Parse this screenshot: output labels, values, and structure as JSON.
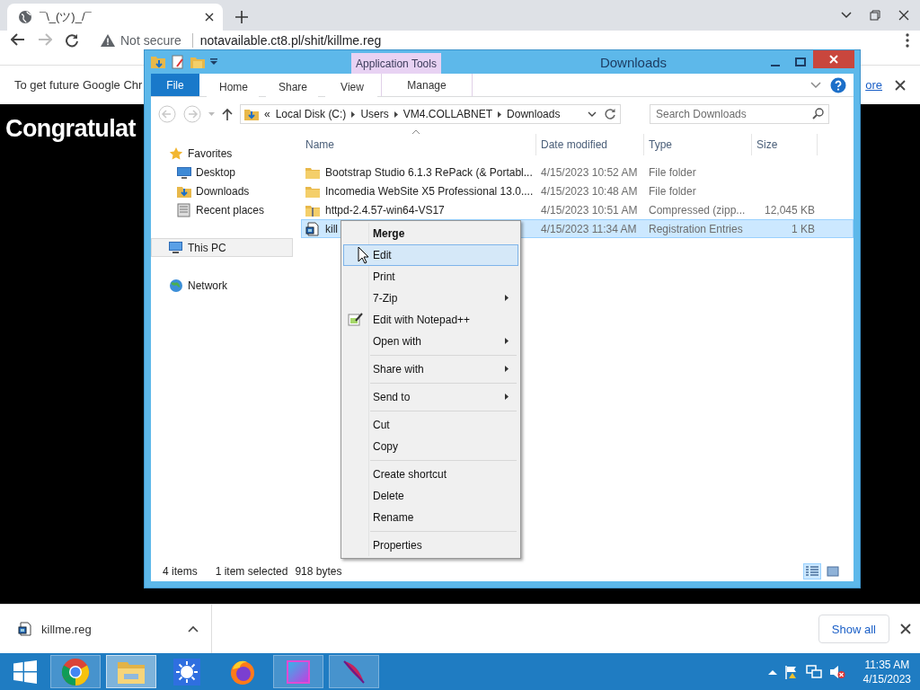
{
  "browser": {
    "tab": {
      "title": "¯\\_(ツ)_/¯"
    },
    "address": {
      "security": "Not secure",
      "url": "notavailable.ct8.pl/shit/killme.reg"
    },
    "infobar": {
      "message": "To get future Google Chr",
      "link": "ore"
    },
    "page": {
      "heading": "Congratulat"
    },
    "download_bar": {
      "file": "killme.reg",
      "button": "Show all"
    }
  },
  "explorer": {
    "title": "Downloads",
    "context_header": "Application Tools",
    "ribbon_tabs": [
      {
        "label": "File",
        "kind": "file"
      },
      {
        "label": "Home",
        "kind": "tab"
      },
      {
        "label": "Share",
        "kind": "tab"
      },
      {
        "label": "View",
        "kind": "tab"
      },
      {
        "label": "Manage",
        "kind": "contextual"
      }
    ],
    "breadcrumb": {
      "overflow": "«",
      "segments": [
        "Local Disk (C:)",
        "Users",
        "VM4.COLLABNET",
        "Downloads"
      ]
    },
    "search": {
      "placeholder": "Search Downloads"
    },
    "navigation": [
      {
        "label": "Favorites",
        "kind": "favorites",
        "selected": false,
        "children": [
          {
            "label": "Desktop",
            "kind": "desktop",
            "selected": false
          },
          {
            "label": "Downloads",
            "kind": "downloads",
            "selected": false
          },
          {
            "label": "Recent places",
            "kind": "recent",
            "selected": false
          }
        ]
      },
      {
        "label": "This PC",
        "kind": "pc",
        "selected": true
      },
      {
        "label": "Network",
        "kind": "network",
        "selected": false
      }
    ],
    "columns": [
      "Name",
      "Date modified",
      "Type",
      "Size"
    ],
    "files": [
      {
        "name": "Bootstrap Studio 6.1.3 RePack (& Portabl...",
        "date": "4/15/2023 10:52 AM",
        "type": "File folder",
        "kind": "folder",
        "selected": false
      },
      {
        "name": "Incomedia WebSite X5 Professional 13.0....",
        "date": "4/15/2023 10:48 AM",
        "type": "File folder",
        "kind": "folder",
        "selected": false
      },
      {
        "name": "httpd-2.4.57-win64-VS17",
        "date": "4/15/2023 10:51 AM",
        "type": "Compressed (zipp...",
        "size": "12,045 KB",
        "kind": "zip",
        "selected": false
      },
      {
        "name": "kill",
        "date": "4/15/2023 11:34 AM",
        "type": "Registration Entries",
        "size": "1 KB",
        "kind": "reg",
        "selected": true
      }
    ],
    "status": {
      "count": "4 items",
      "selection": "1 item selected",
      "bytes": "918 bytes"
    },
    "views": [
      {
        "kind": "details",
        "selected": true
      },
      {
        "kind": "large",
        "selected": false
      }
    ]
  },
  "context_menu": {
    "items": [
      {
        "label": "Merge",
        "kind": "default",
        "selected": false
      },
      {
        "label": "Edit",
        "kind": "item",
        "selected": true
      },
      {
        "label": "Print",
        "kind": "item",
        "selected": false
      },
      {
        "label": "7-Zip",
        "kind": "submenu",
        "selected": false
      },
      {
        "label": "Edit with Notepad++",
        "kind": "icon",
        "selected": false
      },
      {
        "label": "Open with",
        "kind": "submenu",
        "selected": false
      },
      {
        "kind": "separator"
      },
      {
        "label": "Share with",
        "kind": "submenu",
        "selected": false
      },
      {
        "kind": "separator"
      },
      {
        "label": "Send to",
        "kind": "submenu",
        "selected": false
      },
      {
        "kind": "separator"
      },
      {
        "label": "Cut",
        "kind": "item",
        "selected": false
      },
      {
        "label": "Copy",
        "kind": "item",
        "selected": false
      },
      {
        "kind": "separator"
      },
      {
        "label": "Create shortcut",
        "kind": "item",
        "selected": false
      },
      {
        "label": "Delete",
        "kind": "item",
        "selected": false
      },
      {
        "label": "Rename",
        "kind": "item",
        "selected": false
      },
      {
        "kind": "separator"
      },
      {
        "label": "Properties",
        "kind": "item",
        "selected": false
      }
    ]
  },
  "taskbar": {
    "apps": [
      {
        "kind": "chrome",
        "running": true,
        "selected": false
      },
      {
        "kind": "explorer",
        "running": true,
        "selected": true
      },
      {
        "kind": "sun",
        "running": false,
        "selected": false
      },
      {
        "kind": "firefox",
        "running": false,
        "selected": false
      },
      {
        "kind": "cube",
        "running": true,
        "selected": false
      },
      {
        "kind": "feather",
        "running": true,
        "selected": false
      }
    ],
    "time": "11:35 AM",
    "date": "4/15/2023"
  }
}
